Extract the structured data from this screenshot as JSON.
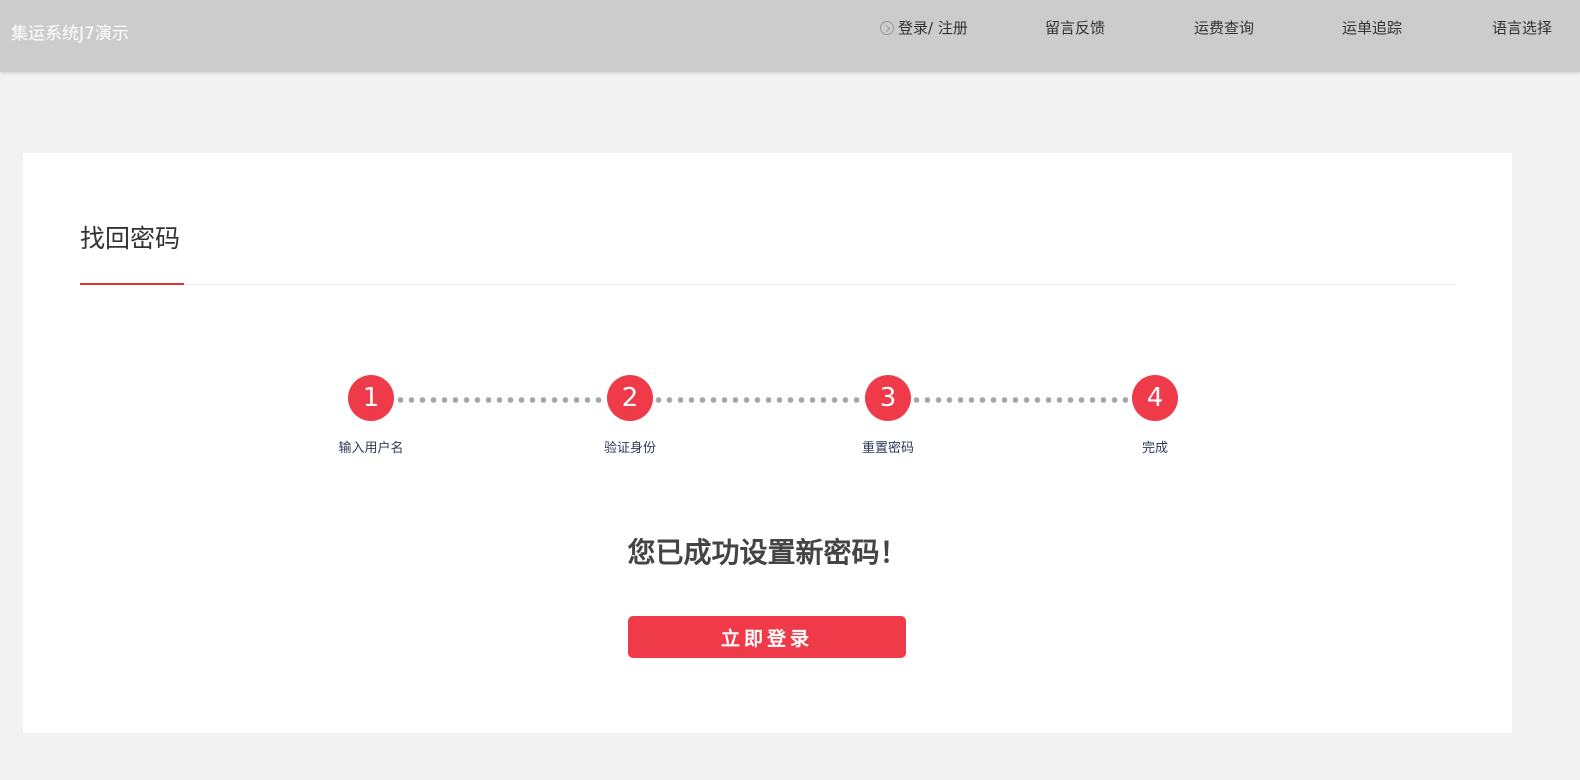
{
  "header": {
    "brand": "集运系统J7演示",
    "nav": {
      "login": "登录/ 注册",
      "feedback": "留言反馈",
      "freight_query": "运费查询",
      "tracking": "运单追踪",
      "language": "语言选择"
    }
  },
  "main": {
    "section_title": "找回密码",
    "steps": [
      {
        "number": "1",
        "label": "输入用户名"
      },
      {
        "number": "2",
        "label": "验证身份"
      },
      {
        "number": "3",
        "label": "重置密码"
      },
      {
        "number": "4",
        "label": "完成"
      }
    ],
    "current_step": 4,
    "success_message": "您已成功设置新密码！",
    "login_button": "立即登录"
  },
  "colors": {
    "accent": "#ef3a4a",
    "header_bg": "#cccccc",
    "page_bg": "#f2f2f2"
  }
}
